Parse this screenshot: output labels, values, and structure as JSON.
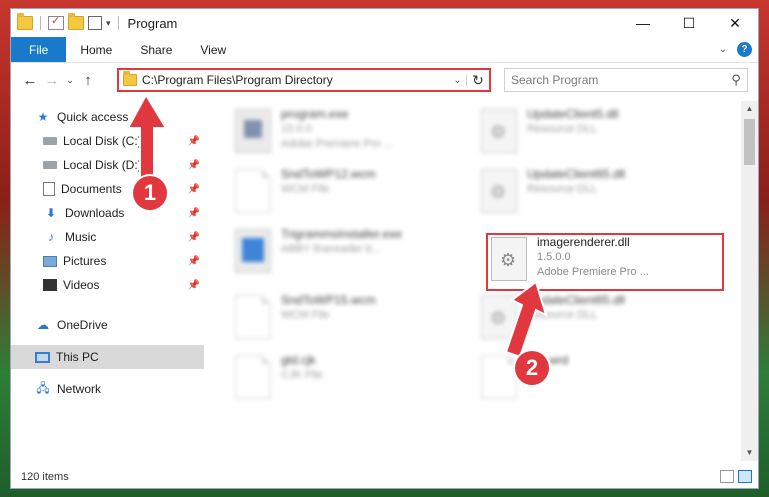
{
  "window": {
    "title": "Program",
    "caption": {
      "minimize": "—",
      "maximize": "☐",
      "close": "✕"
    }
  },
  "ribbon": {
    "tabs": [
      "File",
      "Home",
      "Share",
      "View"
    ],
    "help": "?"
  },
  "address": {
    "path": "C:\\Program Files\\Program Directory",
    "search_placeholder": "Search Program"
  },
  "nav_pane": {
    "items": [
      {
        "label": "Quick access",
        "icon": "star-icon",
        "pinned": false
      },
      {
        "label": "Local Disk (C:)",
        "icon": "disk-icon",
        "pinned": true
      },
      {
        "label": "Local Disk (D:)",
        "icon": "disk-icon",
        "pinned": true
      },
      {
        "label": "Documents",
        "icon": "documents-icon",
        "pinned": true
      },
      {
        "label": "Downloads",
        "icon": "downloads-icon",
        "pinned": true
      },
      {
        "label": "Music",
        "icon": "music-icon",
        "pinned": true
      },
      {
        "label": "Pictures",
        "icon": "pictures-icon",
        "pinned": true
      },
      {
        "label": "Videos",
        "icon": "videos-icon",
        "pinned": true
      },
      {
        "label": "OneDrive",
        "icon": "onedrive-icon",
        "pinned": false
      },
      {
        "label": "This PC",
        "icon": "this-pc-icon",
        "pinned": false,
        "selected": true
      },
      {
        "label": "Network",
        "icon": "network-icon",
        "pinned": false
      }
    ]
  },
  "files": [
    {
      "name": "program.exe",
      "sub1": "15.0.0",
      "sub2": "Adobe Premiere Pro ...",
      "kind": "exe",
      "blurred": true
    },
    {
      "name": "UpdateClient5.dll",
      "sub1": "Resource DLL",
      "kind": "dll",
      "blurred": true
    },
    {
      "name": "SndToWP12.wcm",
      "sub1": "WCM File",
      "kind": "doc",
      "blurred": true
    },
    {
      "name": "UpdateClient65.dll",
      "sub1": "Resource DLL",
      "kind": "dll",
      "blurred": true
    },
    {
      "name": "TrigrammsInstaller.exe",
      "sub1": "ABBY finereader tr...",
      "kind": "exe2",
      "blurred": true
    },
    {
      "name": "imagerenderer.dll",
      "sub1": "1.5.0.0",
      "sub2": "Adobe Premiere Pro ...",
      "kind": "dll",
      "blurred": false
    },
    {
      "name": "SndToWP15.wcm",
      "sub1": "WCM File",
      "kind": "doc",
      "blurred": true
    },
    {
      "name": "UpdateClient65.dll",
      "sub1": "Resource DLL",
      "kind": "dll",
      "blurred": true
    },
    {
      "name": "gtd.cjk",
      "sub1": "CJK File",
      "kind": "doc",
      "blurred": true
    },
    {
      "name": "tbic.wrd",
      "sub1": "File",
      "kind": "doc",
      "blurred": true
    }
  ],
  "status": {
    "items_count": "120 items"
  },
  "annotations": {
    "step1": "1",
    "step2": "2",
    "color": "#e0383e"
  }
}
